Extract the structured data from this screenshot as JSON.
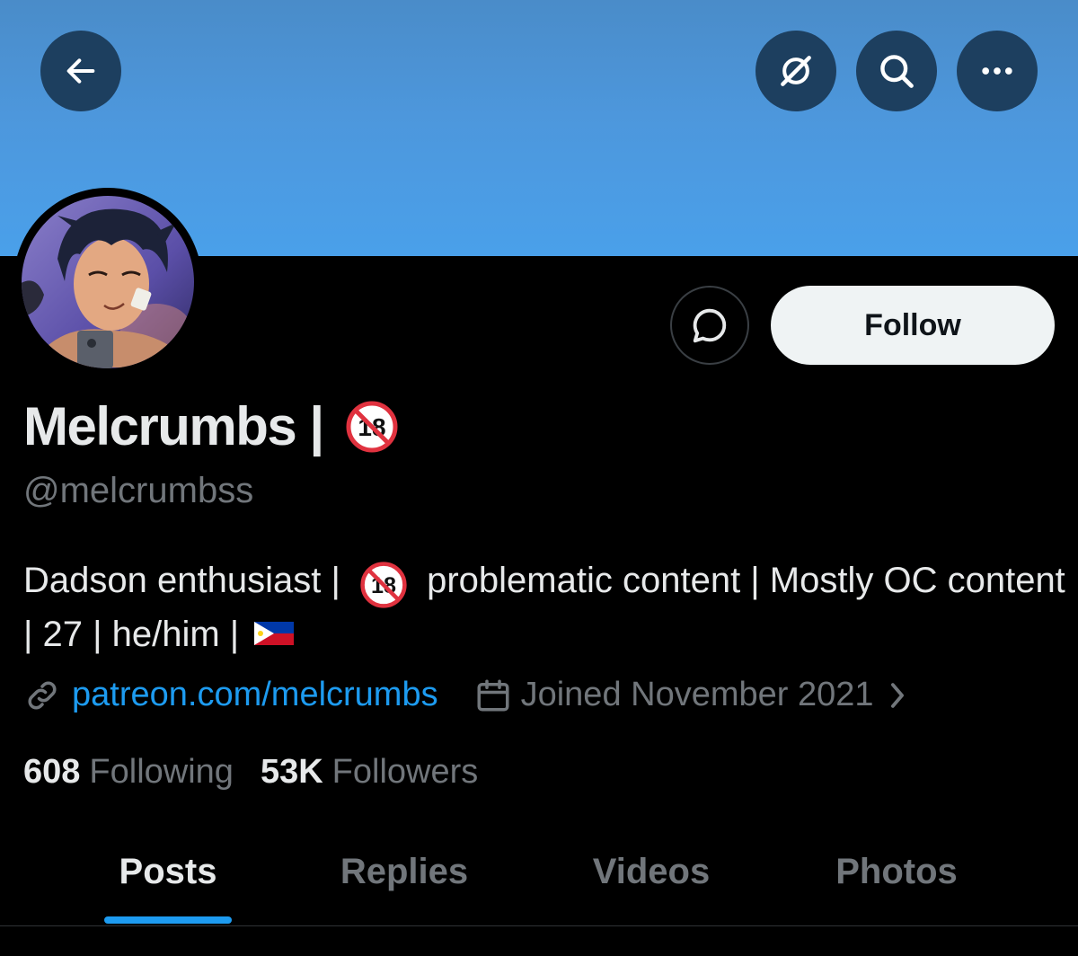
{
  "header": {
    "banner_color": "#4a95dc",
    "buttons": [
      {
        "icon": "back-arrow-icon"
      },
      {
        "icon": "grok-icon"
      },
      {
        "icon": "search-icon"
      },
      {
        "icon": "more-icon"
      }
    ]
  },
  "profile": {
    "display_name": "Melcrumbs |",
    "name_badge": "🔞",
    "handle": "@melcrumbss",
    "bio_part1": "Dadson enthusiast |",
    "bio_badge": "🔞",
    "bio_part2": "problematic content | Mostly OC content | 27 | he/him |",
    "bio_flag": "🇵🇭",
    "link": "patreon.com/melcrumbs",
    "joined": "Joined November 2021",
    "following_count": "608",
    "following_label": "Following",
    "followers_count": "53K",
    "followers_label": "Followers"
  },
  "actions": {
    "follow_label": "Follow"
  },
  "tabs": [
    {
      "label": "Posts",
      "active": true
    },
    {
      "label": "Replies",
      "active": false
    },
    {
      "label": "Videos",
      "active": false
    },
    {
      "label": "Photos",
      "active": false
    }
  ],
  "colors": {
    "accent": "#1d9bf0",
    "background": "#000000",
    "muted_text": "#71767b",
    "primary_text": "#e7e9ea"
  }
}
